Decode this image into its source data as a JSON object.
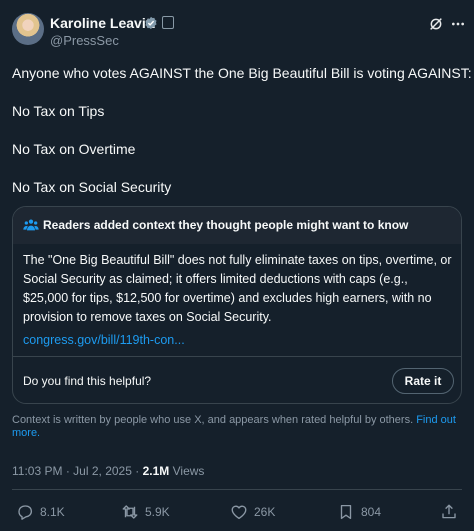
{
  "author": {
    "name": "Karoline Leavitt",
    "handle": "@PressSec"
  },
  "tweet": {
    "lines": [
      "Anyone who votes AGAINST the One Big Beautiful Bill is voting AGAINST:",
      "No Tax on Tips",
      "No Tax on Overtime",
      "No Tax on Social Security"
    ]
  },
  "community_note": {
    "header": "Readers added context they thought people might want to know",
    "body": "The \"One Big Beautiful Bill\" does not fully eliminate taxes on tips, overtime, or Social Security as claimed; it offers limited deductions with caps (e.g., $25,000 for tips, $12,500 for overtime) and excludes high earners, with no provision to remove taxes on Social Security.",
    "link": "congress.gov/bill/119th-con...",
    "helpful_question": "Do you find this helpful?",
    "rate_label": "Rate it"
  },
  "context_info": {
    "text": "Context is written by people who use X, and appears when rated helpful by others.",
    "link": "Find out more."
  },
  "meta": {
    "time": "11:03 PM",
    "date": "Jul 2, 2025",
    "views_count": "2.1M",
    "views_label": "Views"
  },
  "actions": {
    "replies": "8.1K",
    "reposts": "5.9K",
    "likes": "26K",
    "bookmarks": "804"
  },
  "colors": {
    "background": "#15202b",
    "accent": "#1d9bf0",
    "verified": "#829aab",
    "muted": "#8b98a5"
  }
}
